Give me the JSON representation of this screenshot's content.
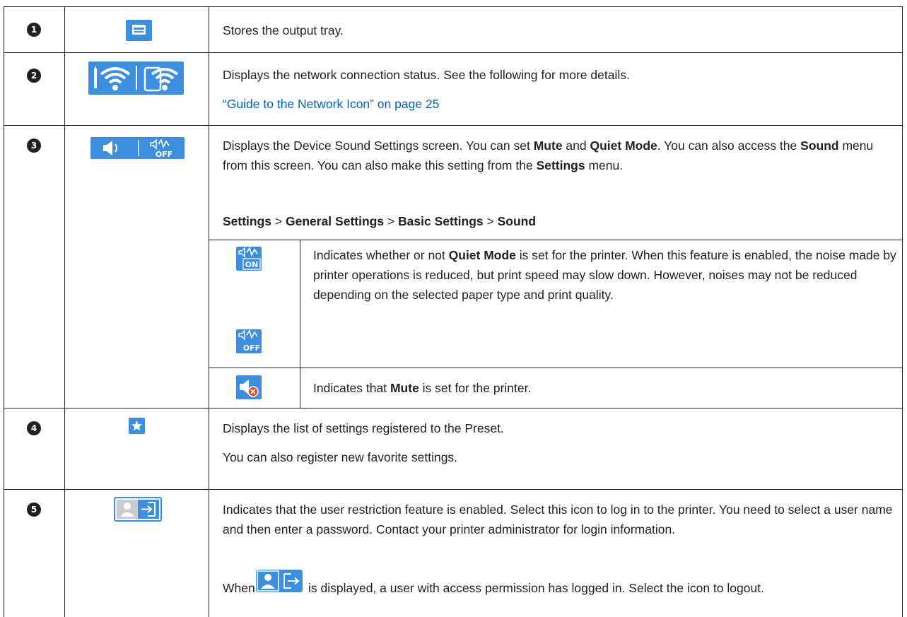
{
  "rows": [
    {
      "num": "1",
      "icon": "output-tray-icon",
      "text": "Stores the output tray."
    },
    {
      "num": "2",
      "icon": "network-status-icon",
      "text": "Displays the network connection status. See the following for more details.",
      "link": "“Guide to the Network Icon” on page 25"
    },
    {
      "num": "3",
      "icon": "device-sound-icon",
      "intro": {
        "a": "Displays the Device Sound Settings screen. You can set ",
        "b": "Mute",
        "c": " and ",
        "d": "Quiet Mode",
        "e": ". You can also access the ",
        "f": "Sound",
        "g": " menu from this screen. You can also make this setting from the ",
        "h": "Settings",
        "i": " menu."
      },
      "path": {
        "p1": "Settings",
        "sep1": " > ",
        "p2": "General Settings",
        "sep2": " > ",
        "p3": "Basic Settings",
        "sep3": " > ",
        "p4": "Sound"
      },
      "sub": [
        {
          "icons": [
            "quiet-mode-on-icon",
            "quiet-mode-off-icon"
          ],
          "a": "Indicates whether or not ",
          "b": "Quiet Mode",
          "c": " is set for the printer. When this feature is enabled, the noise made by printer operations is reduced, but print speed may slow down. However, noises may not be reduced depending on the selected paper type and print quality."
        },
        {
          "icons": [
            "mute-icon"
          ],
          "a": "Indicates that ",
          "b": "Mute",
          "c": " is set for the printer."
        }
      ]
    },
    {
      "num": "4",
      "icon": "preset-star-icon",
      "text": "Displays the list of settings registered to the Preset.",
      "text2": "You can also register new favorite settings."
    },
    {
      "num": "5",
      "icon": "user-login-icon",
      "text": "Indicates that the user restriction feature is enabled. Select this icon to log in to the printer. You need to select a user name and then enter a password. Contact your printer administrator for login information.",
      "when_a": "When ",
      "when_icon": "user-logged-in-icon",
      "when_b": " is displayed, a user with access permission has logged in. Select the icon to logout."
    }
  ],
  "colors": {
    "icon_blue": "#3e8ede",
    "link": "#0062b8",
    "text": "#231f20",
    "mute_x": "#e8452c"
  }
}
